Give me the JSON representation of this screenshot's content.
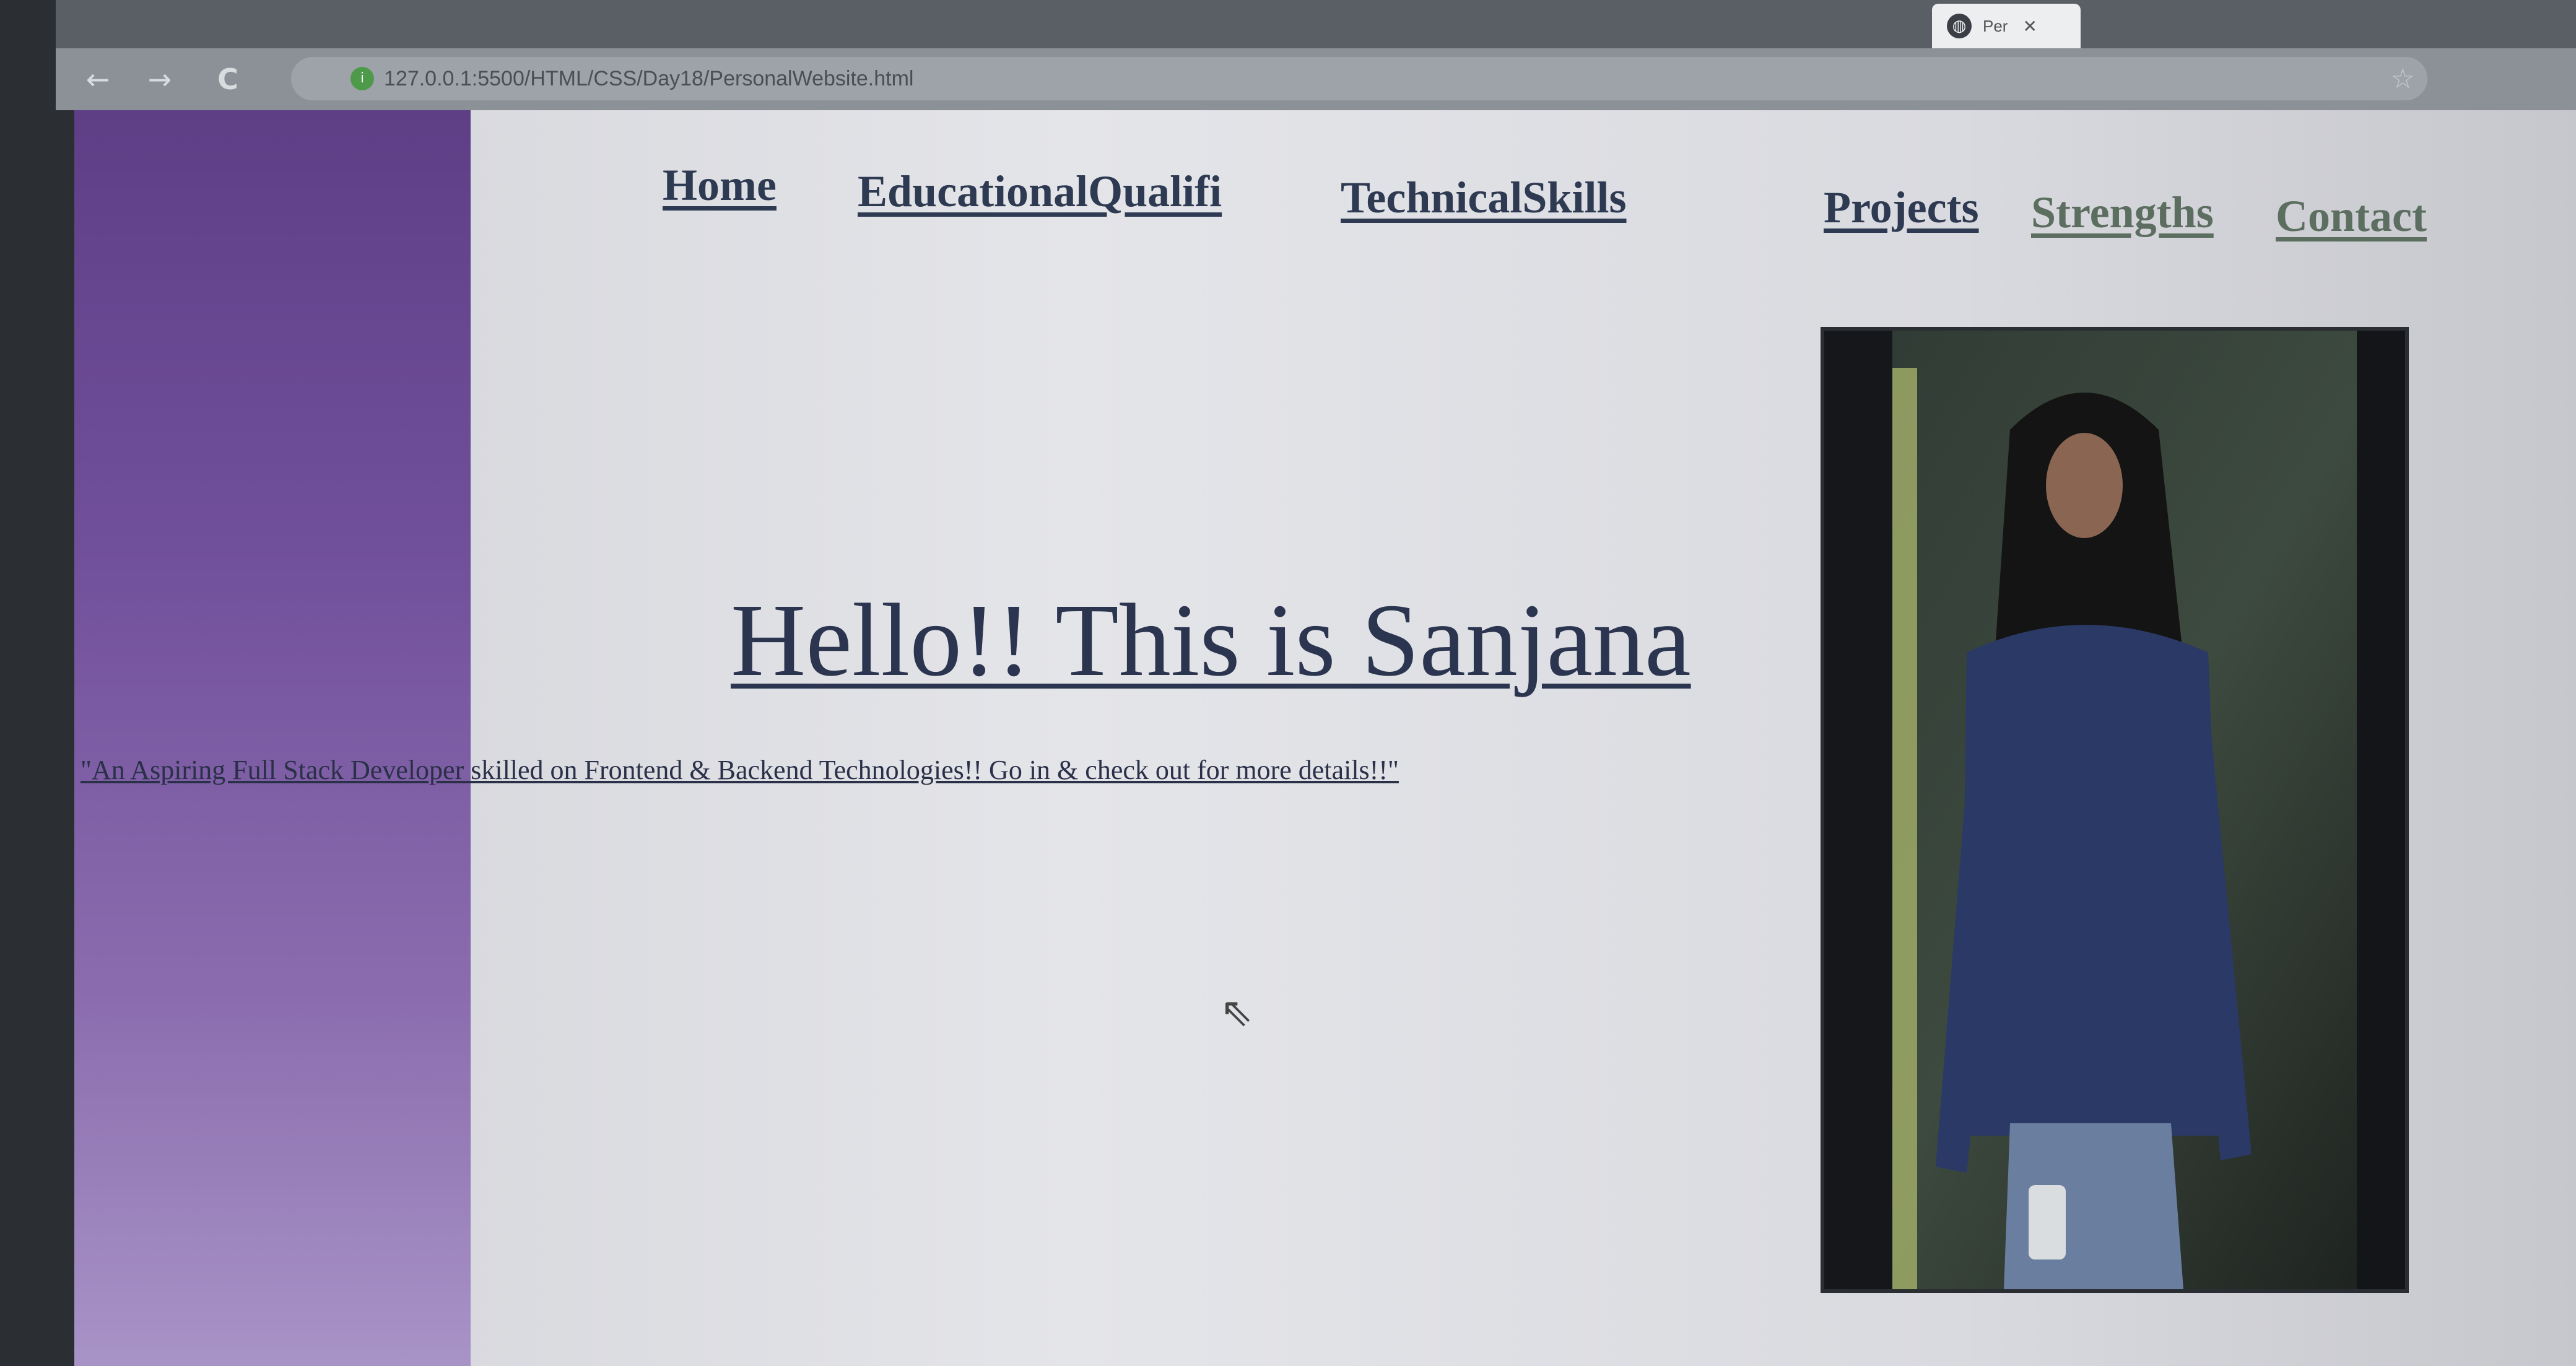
{
  "browser": {
    "tab_title": "Per",
    "tab_close": "✕",
    "url": "127.0.0.1:5500/HTML/CSS/Day18/PersonalWebsite.html",
    "back_icon": "←",
    "forward_icon": "→",
    "reload_icon": "C"
  },
  "nav": {
    "items": [
      {
        "label": "Home"
      },
      {
        "label": "EducationalQualifi"
      },
      {
        "label": "TechnicalSkills"
      },
      {
        "label": "Projects"
      },
      {
        "label": "Strengths"
      },
      {
        "label": "Contact"
      }
    ]
  },
  "hero": {
    "title": "Hello!! This is Sanjana",
    "tagline": "\"An Aspiring Full Stack Developer skilled on Frontend & Backend Technologies!! Go in & check out for more details!!\""
  },
  "colors": {
    "side_panel_top": "#5e3f86",
    "side_panel_bottom": "#a893c6",
    "link": "#2e3a52"
  }
}
